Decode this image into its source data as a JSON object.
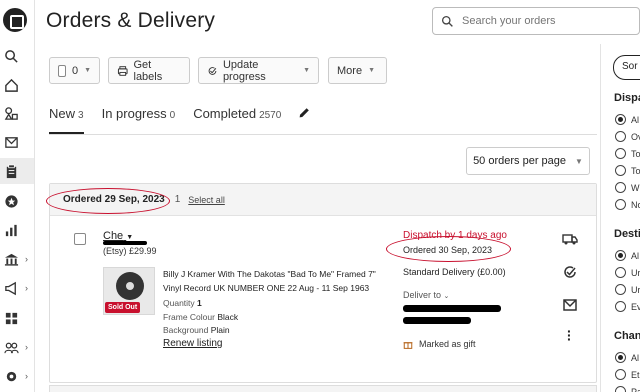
{
  "page": {
    "title": "Orders & Delivery"
  },
  "search": {
    "placeholder": "Search your orders"
  },
  "toolbar": {
    "select_count": "0",
    "get_labels": "Get labels",
    "update_progress": "Update progress",
    "more": "More"
  },
  "tabs": [
    {
      "label": "New",
      "count": "3"
    },
    {
      "label": "In progress",
      "count": "0"
    },
    {
      "label": "Completed",
      "count": "2570"
    }
  ],
  "per_page": "50 orders per page",
  "group": {
    "ordered_date": "Ordered 29 Sep, 2023",
    "count": "1",
    "select_all": "Select all"
  },
  "order": {
    "buyer": "Che",
    "channel_price": "(Etsy) £29.99",
    "sold_out": "Sold Out",
    "item_title": "Billy J Kramer With The Dakotas \"Bad To Me\" Framed 7\" Vinyl Record UK NUMBER ONE 22 Aug - 11 Sep 1963",
    "quantity_label": "Quantity",
    "quantity_value": "1",
    "frame_label": "Frame Colour",
    "frame_value": "Black",
    "background_label": "Background",
    "background_value": "Plain",
    "renew": "Renew listing",
    "dispatch": "Dispatch by 1 days ago",
    "ordered": "Ordered 30 Sep, 2023",
    "delivery": "Standard Delivery",
    "delivery_cost": "(£0.00)",
    "deliver_to": "Deliver to",
    "marked_gift": "Marked as gift"
  },
  "right_panel": {
    "sort": "Sor",
    "sections": [
      {
        "heading": "Dispa",
        "options": [
          "Al",
          "Ov",
          "To",
          "To",
          "W",
          "No"
        ]
      },
      {
        "heading": "Desti",
        "options": [
          "Al",
          "Ur",
          "Ur",
          "Ev"
        ]
      },
      {
        "heading": "Chan",
        "options": [
          "Al",
          "Et",
          "Pa"
        ]
      }
    ]
  },
  "colors": {
    "accent_red": "#c8102e",
    "text": "#222222"
  }
}
